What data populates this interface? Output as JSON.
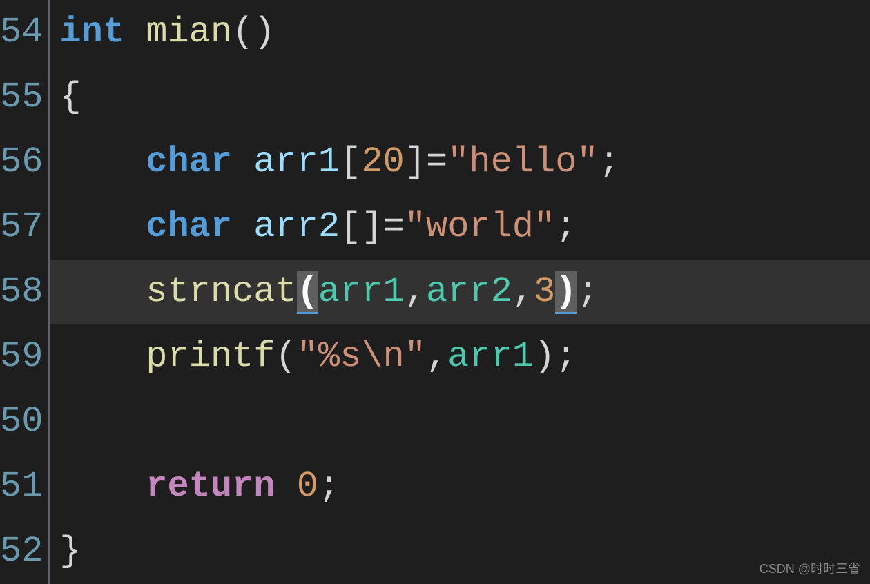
{
  "gutter": {
    "lines": [
      "54",
      "55",
      "56",
      "57",
      "58",
      "59",
      "50",
      "51",
      "52"
    ]
  },
  "code": {
    "l54": {
      "kw_int": "int",
      "sp1": " ",
      "fn": "mian",
      "paren_open": "(",
      "paren_close": ")"
    },
    "l55": {
      "brace_open": "{"
    },
    "l56": {
      "indent": "    ",
      "kw_char": "char",
      "sp1": " ",
      "id": "arr1",
      "lb": "[",
      "size": "20",
      "rb": "]",
      "eq": "=",
      "str": "\"hello\"",
      "semi": ";"
    },
    "l57": {
      "indent": "    ",
      "kw_char": "char",
      "sp1": " ",
      "id": "arr2",
      "lb": "[",
      "rb": "]",
      "eq": "=",
      "str": "\"world\"",
      "semi": ";"
    },
    "l58": {
      "indent": "    ",
      "fn": "strncat",
      "po": "(",
      "a1": "arr1",
      "c1": ",",
      "a2": "arr2",
      "c2": ",",
      "n": "3",
      "pc": ")",
      "semi": ";"
    },
    "l59": {
      "indent": "    ",
      "fn": "printf",
      "po": "(",
      "str": "\"%s\\n\"",
      "c1": ",",
      "a1": "arr1",
      "pc": ")",
      "semi": ";"
    },
    "l60": {
      "blank": ""
    },
    "l61": {
      "indent": "    ",
      "kw_return": "return",
      "sp1": " ",
      "val": "0",
      "semi": ";"
    },
    "l62": {
      "brace_close": "}"
    }
  },
  "watermark": "CSDN @时时三省"
}
